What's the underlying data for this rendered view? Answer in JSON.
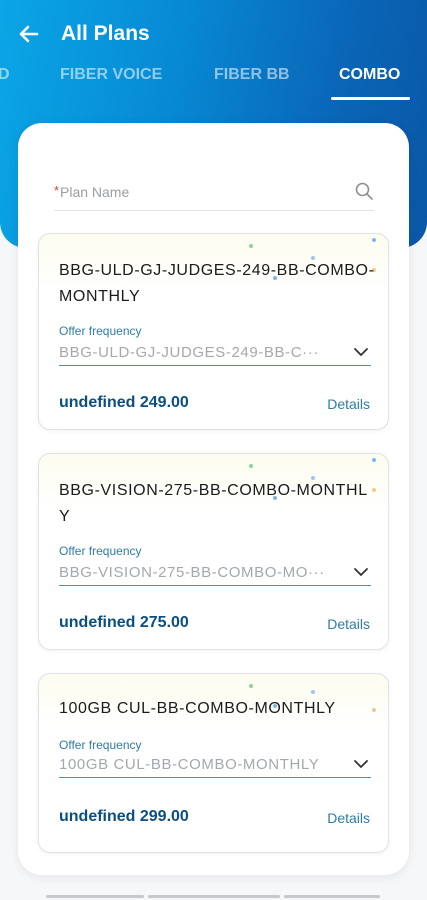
{
  "header": {
    "title": "All Plans"
  },
  "tabs": [
    {
      "label": "D"
    },
    {
      "label": "FIBER VOICE"
    },
    {
      "label": "FIBER BB"
    },
    {
      "label": "COMBO"
    }
  ],
  "search": {
    "required_mark": "*",
    "placeholder": "Plan Name",
    "value": ""
  },
  "plans": [
    {
      "name": "BBG-ULD-GJ-JUDGES-249-BB-COMBO-MONTHLY",
      "offer_label": "Offer frequency",
      "offer_value": "BBG-ULD-GJ-JUDGES-249-BB-C···",
      "price": "undefined 249.00",
      "details_label": "Details"
    },
    {
      "name": "BBG-VISION-275-BB-COMBO-MONTHLY",
      "offer_label": "Offer frequency",
      "offer_value": "BBG-VISION-275-BB-COMBO-MO···",
      "price": "undefined 275.00",
      "details_label": "Details"
    },
    {
      "name": "100GB CUL-BB-COMBO-MONTHLY",
      "offer_label": "Offer frequency",
      "offer_value": "100GB CUL-BB-COMBO-MONTHLY",
      "price": "undefined 299.00",
      "details_label": "Details"
    }
  ],
  "colors": {
    "header_start": "#0aa6e6",
    "header_end": "#0a57a6",
    "price": "#0b4f82",
    "link": "#2e7da3"
  },
  "icons": {
    "back": "arrow-left-icon",
    "search": "search-icon",
    "chevron": "chevron-down-icon"
  }
}
